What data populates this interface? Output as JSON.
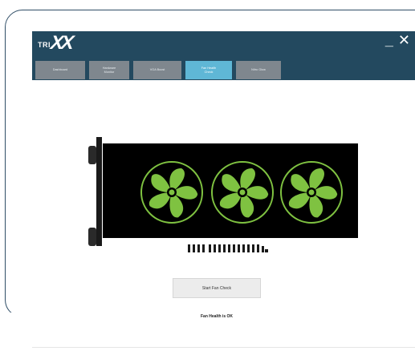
{
  "app": {
    "logo_small": "TRI",
    "logo_big": "XX",
    "minimize_label": "_",
    "close_label": "✕"
  },
  "tabs": [
    {
      "label": "Dashboard"
    },
    {
      "label": "Hardware\nMonitor"
    },
    {
      "label": "VGA Boost"
    },
    {
      "label": "Fan Health\nCheck",
      "active": true
    },
    {
      "label": "Nitro Glow"
    }
  ],
  "main": {
    "start_button_label": "Start Fan Check",
    "status_text": "Fan Health is OK"
  },
  "colors": {
    "titlebar": "#23495f",
    "tab_inactive": "#7f878e",
    "tab_active": "#5fb7d6",
    "fan_green": "#7fc241",
    "card_background": "#000000"
  },
  "icons": {
    "fan": "fan-icon"
  }
}
